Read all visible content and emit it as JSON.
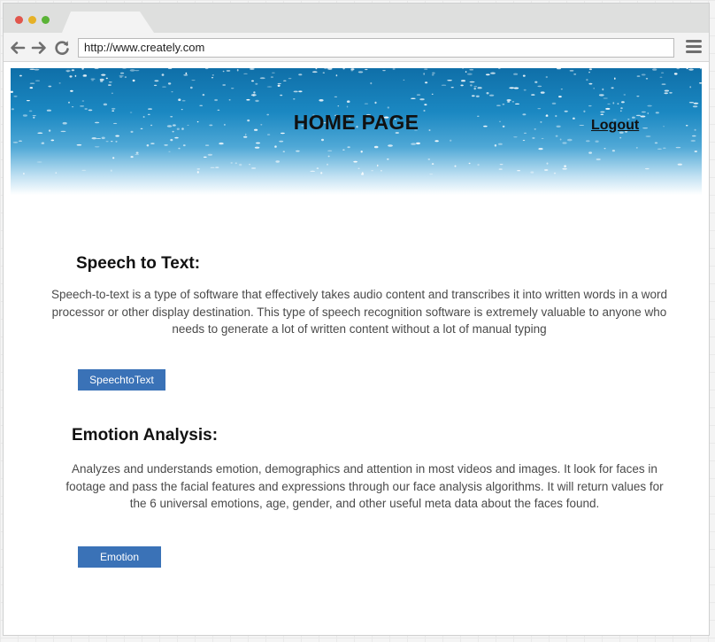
{
  "browser": {
    "url": "http://www.creately.com"
  },
  "header": {
    "title": "HOME PAGE",
    "logout_label": "Logout"
  },
  "sections": [
    {
      "heading": "Speech to Text:",
      "description": "Speech-to-text is a type of software that effectively takes audio content and transcribes it into written words in a word processor or other display destination. This type of speech recognition software is extremely valuable to anyone who needs to generate a lot of written content without a lot of manual typing",
      "button_label": "SpeechtoText"
    },
    {
      "heading": "Emotion Analysis:",
      "description": "Analyzes and understands emotion, demographics and attention in most videos and images. It look for faces in footage and pass the facial features and expressions through our face analysis algorithms. It will return values for the 6 universal emotions, age, gender, and other useful meta data about the faces found.",
      "button_label": "Emotion"
    }
  ],
  "colors": {
    "button": "#3a72b7",
    "banner_top": "#0f6fa8"
  },
  "icons": [
    "back-arrow-icon",
    "forward-arrow-icon",
    "reload-icon",
    "hamburger-menu-icon"
  ]
}
